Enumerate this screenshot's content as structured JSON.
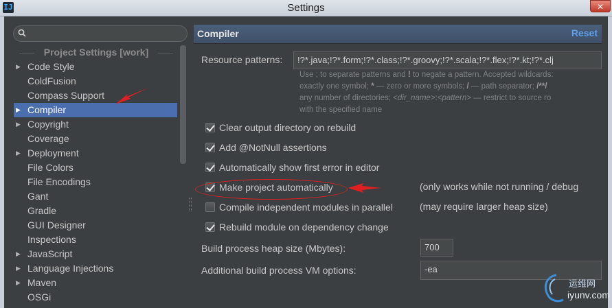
{
  "window": {
    "title": "Settings",
    "app_icon": "IJ",
    "close_glyph": "✕"
  },
  "search": {
    "placeholder": "",
    "value": ""
  },
  "sidebar": {
    "section_header": "Project Settings [work]",
    "items": [
      {
        "label": "Code Style",
        "expandable": true,
        "selected": false
      },
      {
        "label": "ColdFusion",
        "expandable": false,
        "selected": false
      },
      {
        "label": "Compass Support",
        "expandable": false,
        "selected": false
      },
      {
        "label": "Compiler",
        "expandable": true,
        "selected": true
      },
      {
        "label": "Copyright",
        "expandable": true,
        "selected": false
      },
      {
        "label": "Coverage",
        "expandable": false,
        "selected": false
      },
      {
        "label": "Deployment",
        "expandable": true,
        "selected": false
      },
      {
        "label": "File Colors",
        "expandable": false,
        "selected": false
      },
      {
        "label": "File Encodings",
        "expandable": false,
        "selected": false
      },
      {
        "label": "Gant",
        "expandable": false,
        "selected": false
      },
      {
        "label": "Gradle",
        "expandable": false,
        "selected": false
      },
      {
        "label": "GUI Designer",
        "expandable": false,
        "selected": false
      },
      {
        "label": "Inspections",
        "expandable": false,
        "selected": false
      },
      {
        "label": "JavaScript",
        "expandable": true,
        "selected": false
      },
      {
        "label": "Language Injections",
        "expandable": true,
        "selected": false
      },
      {
        "label": "Maven",
        "expandable": true,
        "selected": false
      },
      {
        "label": "OSGi",
        "expandable": false,
        "selected": false
      }
    ]
  },
  "panel": {
    "title": "Compiler",
    "reset_label": "Reset",
    "resource_patterns": {
      "label": "Resource patterns:",
      "value": "!?*.java;!?*.form;!?*.class;!?*.groovy;!?*.scala;!?*.flex;!?*.kt;!?*.clj"
    },
    "hint": {
      "line1_a": "Use ; to separate patterns and ",
      "line1_b": "!",
      "line1_c": " to negate a pattern. Accepted wildcards: ",
      "line2_a": "exactly one symbol; ",
      "line2_b": "*",
      "line2_c": " — zero or more symbols; ",
      "line2_d": "/",
      "line2_e": " — path separator; ",
      "line2_f": "/**/",
      "line3_a": "any number of directories; ",
      "line3_b": "<dir_name>",
      "line3_c": ":",
      "line3_d": "<pattern>",
      "line3_e": " — restrict to source ro",
      "line4": "with the specified name"
    },
    "options": [
      {
        "label": "Clear output directory on rebuild",
        "checked": true,
        "note": ""
      },
      {
        "label": "Add @NotNull assertions",
        "checked": true,
        "note": ""
      },
      {
        "label": "Automatically show first error in editor",
        "checked": true,
        "note": ""
      },
      {
        "label": "Make project automatically",
        "checked": true,
        "note": "(only works while not running / debug"
      },
      {
        "label": "Compile independent modules in parallel",
        "checked": false,
        "note": "(may require larger heap size)"
      },
      {
        "label": "Rebuild module on dependency change",
        "checked": true,
        "note": ""
      }
    ],
    "heap_size": {
      "label": "Build process heap size (Mbytes):",
      "value": "700"
    },
    "vm_options": {
      "label": "Additional build process VM options:",
      "value": "-ea"
    }
  },
  "annotations": {
    "arrow_color": "#e02020"
  },
  "watermark": {
    "cn": "运维网",
    "en": "iyunv.com"
  },
  "colors": {
    "selection": "#4b6eaf",
    "background": "#3c3f41",
    "link": "#5e9ee8"
  }
}
